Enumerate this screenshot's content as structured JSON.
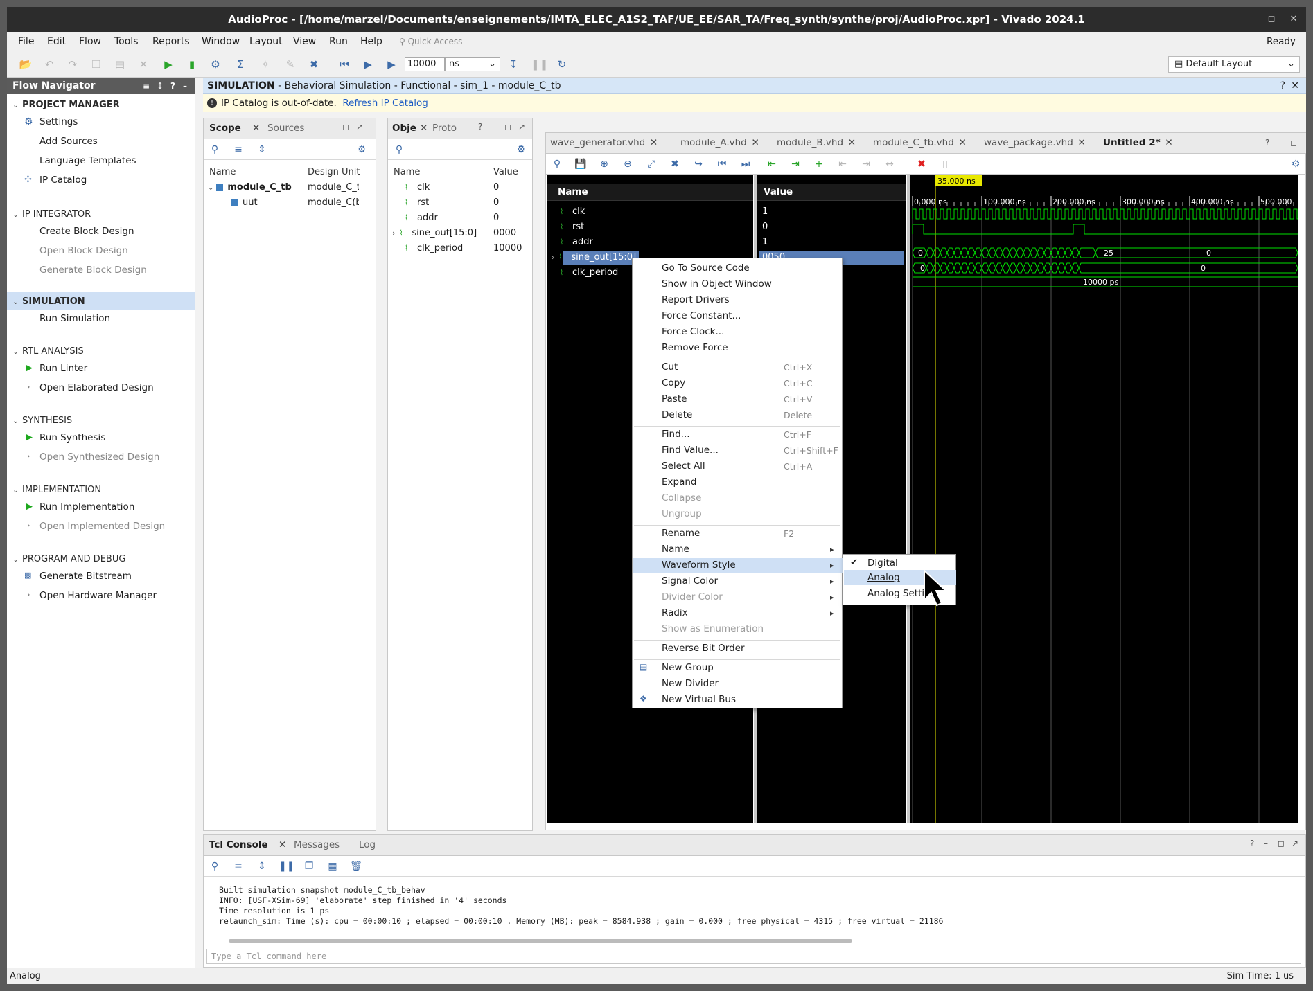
{
  "window": {
    "title": "AudioProc - [/home/marzel/Documents/enseignements/IMTA_ELEC_A1S2_TAF/UE_EE/SAR_TA/Freq_synth/synthe/proj/AudioProc.xpr] - Vivado 2024.1"
  },
  "menubar": {
    "items": [
      "File",
      "Edit",
      "Flow",
      "Tools",
      "Reports",
      "Window",
      "Layout",
      "View",
      "Run",
      "Help"
    ],
    "quick_access": "Quick Access",
    "status": "Ready"
  },
  "toolbar": {
    "run_time": "10000",
    "time_unit": "ns",
    "layout": "Default Layout"
  },
  "flow_navigator": {
    "title": "Flow Navigator",
    "sections": [
      {
        "label": "PROJECT MANAGER",
        "items": [
          "Settings",
          "Add Sources",
          "Language Templates",
          "IP Catalog"
        ]
      },
      {
        "label": "IP INTEGRATOR",
        "items": [
          "Create Block Design",
          "Open Block Design",
          "Generate Block Design"
        ]
      },
      {
        "label": "SIMULATION",
        "items": [
          "Run Simulation"
        ]
      },
      {
        "label": "RTL ANALYSIS",
        "items": [
          "Run Linter",
          "Open Elaborated Design"
        ]
      },
      {
        "label": "SYNTHESIS",
        "items": [
          "Run Synthesis",
          "Open Synthesized Design"
        ]
      },
      {
        "label": "IMPLEMENTATION",
        "items": [
          "Run Implementation",
          "Open Implemented Design"
        ]
      },
      {
        "label": "PROGRAM AND DEBUG",
        "items": [
          "Generate Bitstream",
          "Open Hardware Manager"
        ]
      }
    ]
  },
  "sim_header": {
    "strong": "SIMULATION",
    "text": " - Behavioral Simulation - Functional - sim_1 - module_C_tb"
  },
  "info_bar": {
    "text": "IP Catalog is out-of-date.",
    "link": "Refresh IP Catalog"
  },
  "scope_panel": {
    "tabs": [
      "Scope",
      "Sources"
    ],
    "columns": [
      "Name",
      "Design Unit"
    ],
    "rows": [
      {
        "name": "module_C_tb",
        "unit": "module_C_tl"
      },
      {
        "name": "uut",
        "unit": "module_C(b"
      }
    ]
  },
  "objects_panel": {
    "tabs": [
      "Obje",
      "Proto"
    ],
    "columns": [
      "Name",
      "Value"
    ],
    "rows": [
      {
        "name": "clk",
        "value": "0"
      },
      {
        "name": "rst",
        "value": "0"
      },
      {
        "name": "addr",
        "value": "0"
      },
      {
        "name": "sine_out[15:0]",
        "value": "0000"
      },
      {
        "name": "clk_period",
        "value": "10000"
      }
    ]
  },
  "wave_panel": {
    "tabs": [
      "wave_generator.vhd",
      "module_A.vhd",
      "module_B.vhd",
      "module_C_tb.vhd",
      "wave_package.vhd",
      "Untitled 2*"
    ],
    "name_header": "Name",
    "value_header": "Value",
    "cursor_time": "35.000 ns",
    "time_ticks": [
      "0.000 ns",
      "100.000 ns",
      "200.000 ns",
      "300.000 ns",
      "400.000 ns",
      "500.000"
    ],
    "signals": [
      {
        "name": "clk",
        "value": "1"
      },
      {
        "name": "rst",
        "value": "0"
      },
      {
        "name": "addr",
        "value": "1"
      },
      {
        "name": "sine_out[15:0]",
        "value": "0050"
      },
      {
        "name": "clk_period",
        "value": ""
      }
    ],
    "wave_labels": {
      "addr_start": "0",
      "addr_mid": "25",
      "addr_end": "0",
      "sine_start": "0",
      "sine_end": "0",
      "period": "10000 ps"
    }
  },
  "context_menu": {
    "items": [
      {
        "label": "Go To Source Code",
        "shortcut": ""
      },
      {
        "label": "Show in Object Window",
        "shortcut": ""
      },
      {
        "label": "Report Drivers",
        "shortcut": ""
      },
      {
        "label": "Force Constant...",
        "shortcut": ""
      },
      {
        "label": "Force Clock...",
        "shortcut": ""
      },
      {
        "label": "Remove Force",
        "shortcut": ""
      },
      {
        "label": "Cut",
        "shortcut": "Ctrl+X"
      },
      {
        "label": "Copy",
        "shortcut": "Ctrl+C"
      },
      {
        "label": "Paste",
        "shortcut": "Ctrl+V"
      },
      {
        "label": "Delete",
        "shortcut": "Delete"
      },
      {
        "label": "Find...",
        "shortcut": "Ctrl+F"
      },
      {
        "label": "Find Value...",
        "shortcut": "Ctrl+Shift+F"
      },
      {
        "label": "Select All",
        "shortcut": "Ctrl+A"
      },
      {
        "label": "Expand",
        "shortcut": ""
      },
      {
        "label": "Collapse",
        "shortcut": ""
      },
      {
        "label": "Ungroup",
        "shortcut": ""
      },
      {
        "label": "Rename",
        "shortcut": "F2"
      },
      {
        "label": "Name",
        "shortcut": ""
      },
      {
        "label": "Waveform Style",
        "shortcut": ""
      },
      {
        "label": "Signal Color",
        "shortcut": ""
      },
      {
        "label": "Divider Color",
        "shortcut": ""
      },
      {
        "label": "Radix",
        "shortcut": ""
      },
      {
        "label": "Show as Enumeration",
        "shortcut": ""
      },
      {
        "label": "Reverse Bit Order",
        "shortcut": ""
      },
      {
        "label": "New Group",
        "shortcut": ""
      },
      {
        "label": "New Divider",
        "shortcut": ""
      },
      {
        "label": "New Virtual Bus",
        "shortcut": ""
      }
    ]
  },
  "submenu": {
    "items": [
      "Digital",
      "Analog",
      "Analog Setti..."
    ]
  },
  "tcl_console": {
    "tabs": [
      "Tcl Console",
      "Messages",
      "Log"
    ],
    "lines": [
      "Built simulation snapshot module_C_tb_behav",
      "INFO: [USF-XSim-69] 'elaborate' step finished in '4' seconds",
      "Time resolution is 1 ps",
      "relaunch_sim: Time (s): cpu = 00:00:10 ; elapsed = 00:00:10 . Memory (MB): peak = 8584.938 ; gain = 0.000 ; free physical = 4315 ; free virtual = 21186"
    ],
    "placeholder": "Type a Tcl command here"
  },
  "status_bar": {
    "left": "Analog",
    "right": "Sim Time: 1 us"
  },
  "colors": {
    "accent": "#cfe0f5",
    "wave_green": "#00e000",
    "cursor_yellow": "#e8e800"
  }
}
